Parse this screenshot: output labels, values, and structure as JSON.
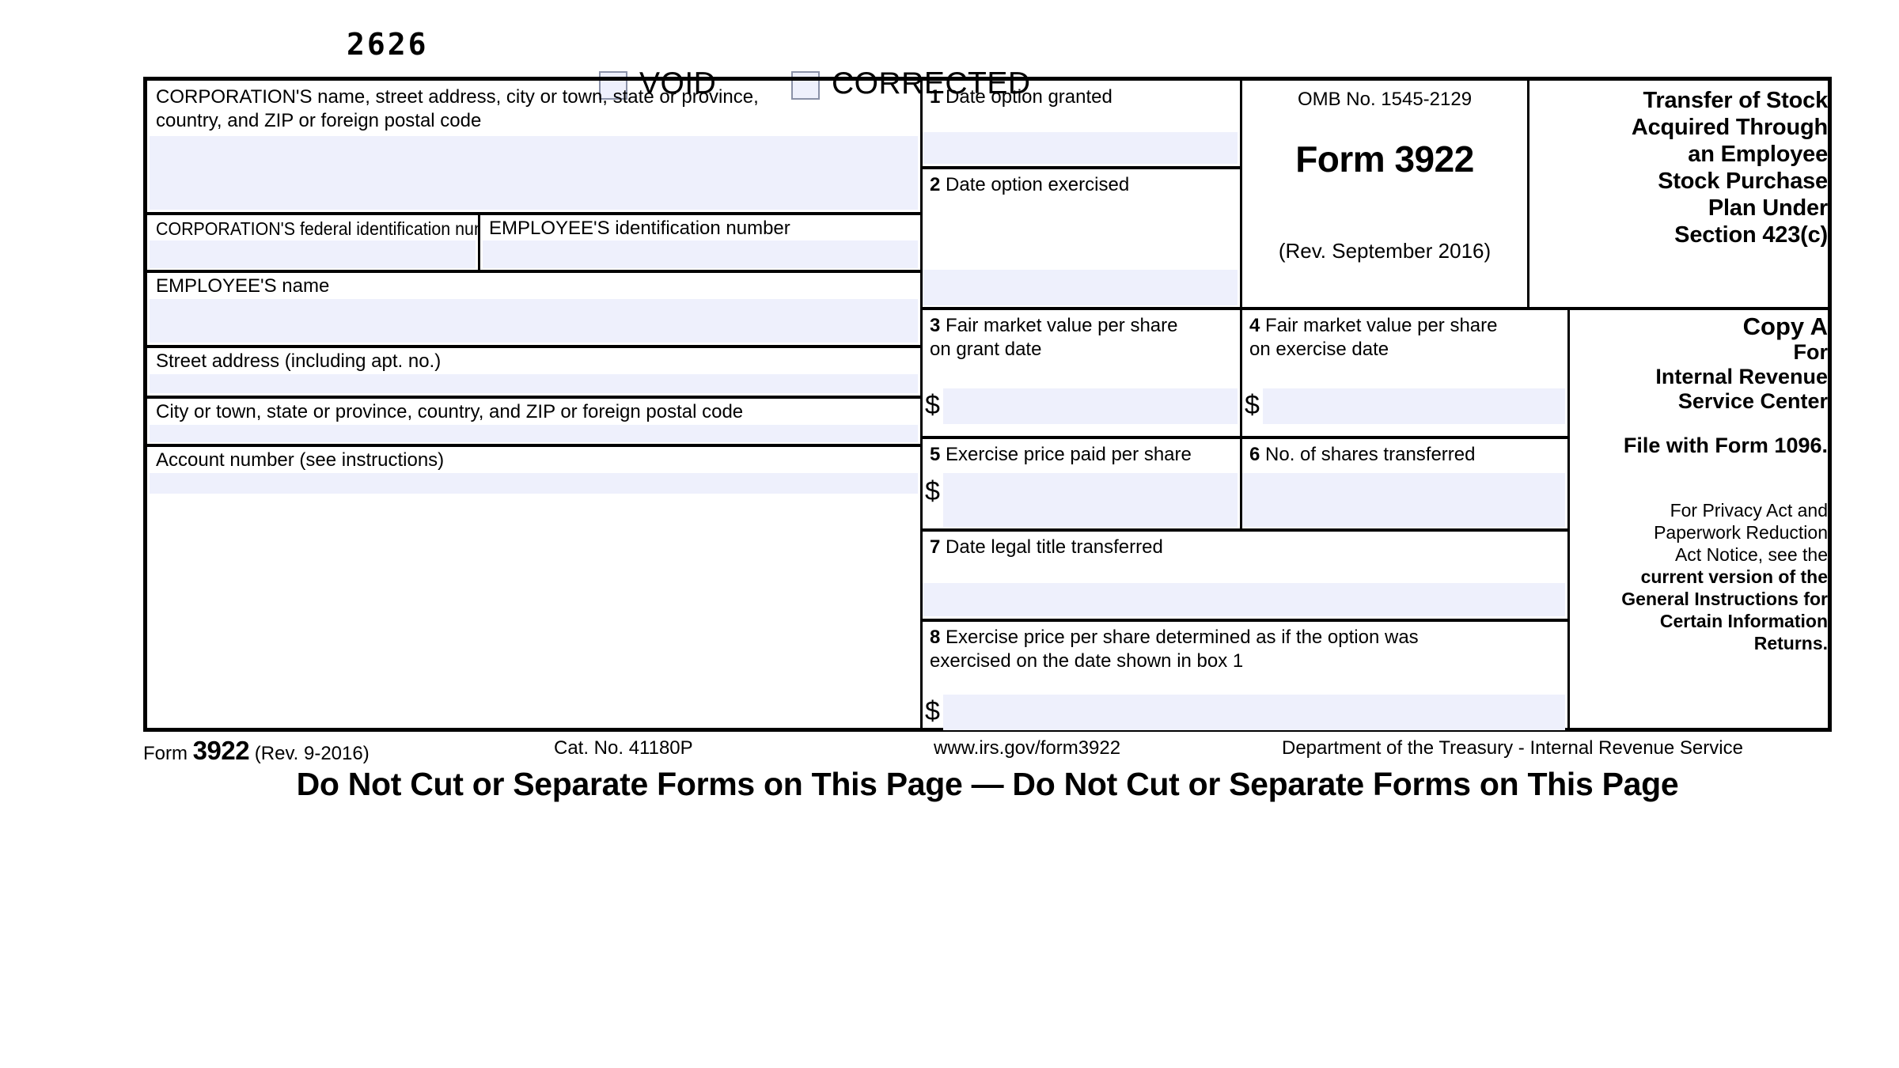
{
  "header": {
    "form_number_stamp": "2626",
    "void_label": "VOID",
    "corrected_label": "CORRECTED"
  },
  "left_column": {
    "corporation_block_label": "CORPORATION'S name, street address, city or town, state or province,\ncountry, and ZIP or foreign postal code",
    "corporation_tin_label": "CORPORATION'S federal identification number",
    "employee_tin_label": "EMPLOYEE'S identification number",
    "employee_name_label": "EMPLOYEE'S name",
    "street_address_label": "Street address (including apt. no.)",
    "city_state_label": "City or town, state or province, country, and ZIP or foreign postal code",
    "account_number_label": "Account number (see instructions)"
  },
  "boxes": [
    {
      "num": "1",
      "label": "Date option granted",
      "dollar": false
    },
    {
      "num": "2",
      "label": "Date option exercised",
      "dollar": false
    },
    {
      "num": "3",
      "label": "Fair market value per share\n    on grant date",
      "dollar": true
    },
    {
      "num": "4",
      "label": "Fair market value per share\n    on exercise date",
      "dollar": true
    },
    {
      "num": "5",
      "label": "Exercise price paid per share",
      "dollar": true
    },
    {
      "num": "6",
      "label": "No. of shares transferred",
      "dollar": false
    },
    {
      "num": "7",
      "label": "Date legal title transferred",
      "dollar": false
    },
    {
      "num": "8",
      "label": "Exercise price per share determined as if the option was\n    exercised on the date shown in box 1",
      "dollar": true
    }
  ],
  "omb": {
    "omb_no": "OMB No. 1545-2129",
    "form_title": "Form 3922",
    "revision": "(Rev. September 2016)"
  },
  "title_block": {
    "lines": [
      "Transfer of Stock",
      "Acquired Through",
      "an Employee",
      "Stock Purchase",
      "Plan Under",
      "Section 423(c)"
    ]
  },
  "copy_block": {
    "copy_a": "Copy A",
    "for": "For",
    "internal_revenue": "Internal Revenue",
    "service_center": "Service Center",
    "file_with": "File with Form 1096.",
    "privacy_plain_1": "For Privacy Act and",
    "privacy_plain_2": "Paperwork Reduction",
    "privacy_plain_3": "Act Notice, see the",
    "privacy_bold_1": "current version of the",
    "privacy_bold_2": "General Instructions for",
    "privacy_bold_3": "Certain Information",
    "privacy_bold_4": "Returns."
  },
  "footer": {
    "form_word": "Form",
    "form_number": "3922",
    "form_rev": "(Rev. 9-2016)",
    "cat_no": "Cat. No. 41180P",
    "website": "www.irs.gov/form3922",
    "department": "Department of the Treasury - Internal Revenue Service",
    "do_not_cut": "Do Not Cut or Separate Forms on This Page — Do Not Cut or Separate Forms on This Page"
  },
  "colors": {
    "field_fill": "#eef0fc",
    "rule": "#000000",
    "checkbox_border": "#8a91a8"
  }
}
